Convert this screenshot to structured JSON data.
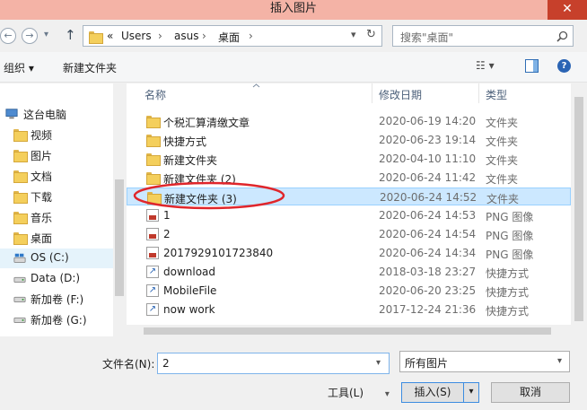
{
  "window": {
    "title": "插入图片",
    "close": "✕"
  },
  "nav": {
    "back": "←",
    "forward": "→",
    "dropdown": "▾",
    "up": "↑",
    "address_segments": [
      "«",
      "Users",
      "›",
      "asus",
      "›",
      "桌面",
      "›"
    ],
    "address_dropdown": "▾",
    "refresh": "↻",
    "search_placeholder": "搜索\"桌面\""
  },
  "toolbar": {
    "organize": "组织 ▾",
    "new_folder": "新建文件夹",
    "view": "☷ ▾",
    "help": "?"
  },
  "sidebar": {
    "items": [
      {
        "label": "这台电脑",
        "icon": "computer-icon"
      },
      {
        "label": "视频",
        "icon": "video-folder-icon"
      },
      {
        "label": "图片",
        "icon": "pictures-folder-icon"
      },
      {
        "label": "文档",
        "icon": "documents-folder-icon"
      },
      {
        "label": "下载",
        "icon": "downloads-folder-icon"
      },
      {
        "label": "音乐",
        "icon": "music-folder-icon"
      },
      {
        "label": "桌面",
        "icon": "desktop-folder-icon"
      },
      {
        "label": "OS (C:)",
        "icon": "os-drive-icon"
      },
      {
        "label": "Data (D:)",
        "icon": "drive-icon"
      },
      {
        "label": "新加卷 (F:)",
        "icon": "drive-icon"
      },
      {
        "label": "新加卷 (G:)",
        "icon": "drive-icon"
      }
    ]
  },
  "list": {
    "columns": {
      "name": "名称",
      "date": "修改日期",
      "type": "类型"
    },
    "rows": [
      {
        "name": "个税汇算清缴文章",
        "date": "2020-06-19 14:20",
        "type": "文件夹",
        "kind": "folder"
      },
      {
        "name": "快捷方式",
        "date": "2020-06-23 19:14",
        "type": "文件夹",
        "kind": "folder"
      },
      {
        "name": "新建文件夹",
        "date": "2020-04-10 11:10",
        "type": "文件夹",
        "kind": "folder"
      },
      {
        "name": "新建文件夹 (2)",
        "date": "2020-06-24 11:42",
        "type": "文件夹",
        "kind": "folder"
      },
      {
        "name": "新建文件夹 (3)",
        "date": "2020-06-24 14:52",
        "type": "文件夹",
        "kind": "folder",
        "selected": true
      },
      {
        "name": "1",
        "date": "2020-06-24 14:53",
        "type": "PNG 图像",
        "kind": "png"
      },
      {
        "name": "2",
        "date": "2020-06-24 14:54",
        "type": "PNG 图像",
        "kind": "png"
      },
      {
        "name": "2017929101723840",
        "date": "2020-06-24 14:34",
        "type": "PNG 图像",
        "kind": "png"
      },
      {
        "name": "download",
        "date": "2018-03-18 23:27",
        "type": "快捷方式",
        "kind": "shortcut"
      },
      {
        "name": "MobileFile",
        "date": "2020-06-20 23:25",
        "type": "快捷方式",
        "kind": "shortcut"
      },
      {
        "name": "now work",
        "date": "2017-12-24 21:36",
        "type": "快捷方式",
        "kind": "shortcut"
      }
    ]
  },
  "bottom": {
    "filename_label": "文件名(N):",
    "filename_value": "2",
    "filter_value": "所有图片",
    "tools": "工具(L)",
    "insert": "插入(S)",
    "cancel": "取消",
    "dropdown": "▾"
  }
}
